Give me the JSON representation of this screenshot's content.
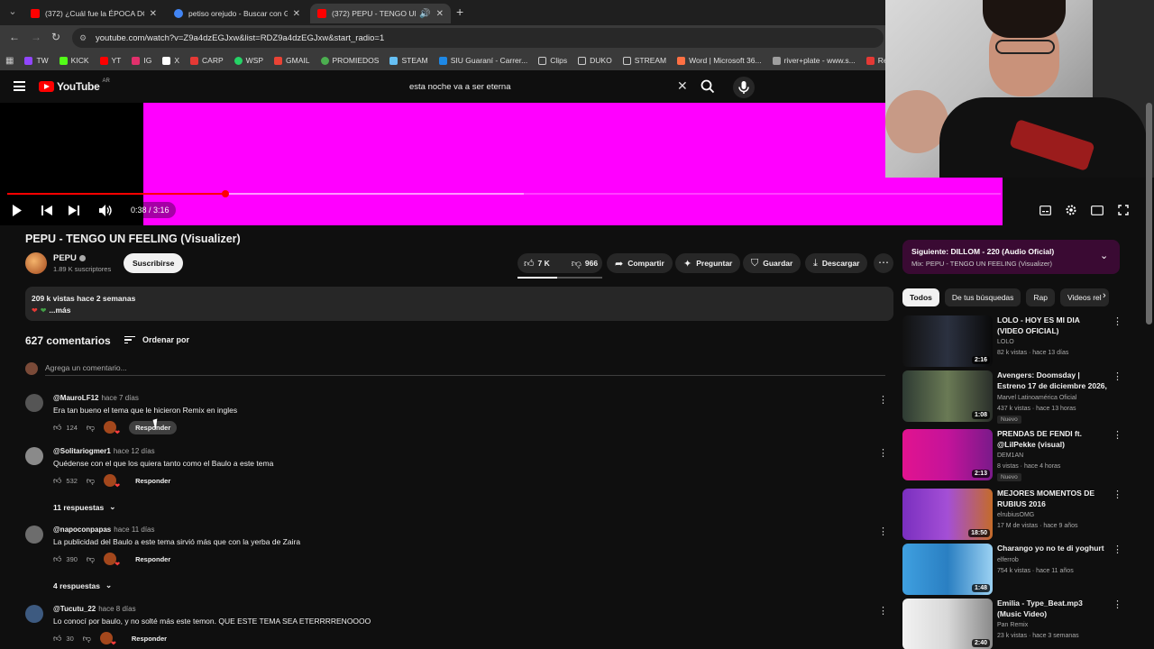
{
  "browser": {
    "tabs": [
      {
        "title": "(372) ¿Cuál fue la ÉPOCA DORA",
        "favicon_color": "#ff0000",
        "active": false
      },
      {
        "title": "petiso orejudo - Buscar con Go",
        "favicon_color": "#4285f4",
        "active": false
      },
      {
        "title": "(372) PEPU - TENGO UN FE",
        "favicon_color": "#ff0000",
        "active": true
      }
    ],
    "new_tab": "+",
    "url": "youtube.com/watch?v=Z9a4dzEGJxw&list=RDZ9a4dzEGJxw&start_radio=1",
    "bookmarks": [
      {
        "label": "TW",
        "color": "#1d9bf0"
      },
      {
        "label": "KICK",
        "color": "#53fc18"
      },
      {
        "label": "YT",
        "color": "#ff0000"
      },
      {
        "label": "IG",
        "color": "#e1306c"
      },
      {
        "label": "X",
        "color": "#ffffff"
      },
      {
        "label": "CARP",
        "color": "#e53935"
      },
      {
        "label": "WSP",
        "color": "#25d366"
      },
      {
        "label": "GMAIL",
        "color": "#ea4335"
      },
      {
        "label": "PROMIEDOS",
        "color": "#4caf50"
      },
      {
        "label": "STEAM",
        "color": "#66c0f4"
      },
      {
        "label": "SIU Guaraní - Carrer...",
        "color": "#1e88e5"
      },
      {
        "label": "Clips",
        "color": "#9e9e9e"
      },
      {
        "label": "DUKO",
        "color": "#9e9e9e"
      },
      {
        "label": "STREAM",
        "color": "#9e9e9e"
      },
      {
        "label": "Word | Microsoft 36...",
        "color": "#ff7043"
      },
      {
        "label": "river+plate - www.s...",
        "color": "#9e9e9e"
      },
      {
        "label": "Retro Co",
        "color": "#e53935"
      }
    ]
  },
  "youtube": {
    "logo_text": "YouTube",
    "country": "AR",
    "search_query": "esta noche va a ser eterna"
  },
  "player": {
    "current_time": "0:38",
    "duration": "3:16",
    "progress_fraction": 0.22,
    "buffer_fraction": 0.52
  },
  "video": {
    "title": "PEPU - TENGO UN FEELING (Visualizer)",
    "channel": "PEPU",
    "subscribers": "1.89 K suscriptores",
    "subscribe_label": "Suscribirse",
    "likes": "7 K",
    "dislikes": "966",
    "share_label": "Compartir",
    "ask_label": "Preguntar",
    "save_label": "Guardar",
    "download_label": "Descargar",
    "views_time": "209 k vistas  hace 2 semanas",
    "more_label": "...más"
  },
  "comments_section": {
    "count": "627 comentarios",
    "sort_label": "Ordenar por",
    "add_placeholder": "Agrega un comentario...",
    "reply_label": "Responder",
    "comments": [
      {
        "author": "@MauroLF12",
        "time": "hace 7 días",
        "text": "Era tan bueno el tema que le hicieron Remix en ingles",
        "likes": "124",
        "replies": "",
        "avatar_color": "#555555"
      },
      {
        "author": "@Solitariogmer1",
        "time": "hace 12 días",
        "text": "Quédense con el que los quiera tanto como el Baulo a este tema",
        "likes": "532",
        "replies": "11 respuestas",
        "avatar_color": "#8a8a8a"
      },
      {
        "author": "@napoconpapas",
        "time": "hace 11 días",
        "text": "La publicidad del Baulo a este tema sirvió más que con la yerba de Zaira",
        "likes": "390",
        "replies": "4 respuestas",
        "avatar_color": "#6d6d6d"
      },
      {
        "author": "@Tucutu_22",
        "time": "hace 8 días",
        "text": "Lo conocí por baulo, y no solté más este temon. QUE ESTE TEMA SEA ETERRRRENOOOO",
        "likes": "30",
        "replies": "",
        "avatar_color": "#3d5a80"
      }
    ]
  },
  "sidebar": {
    "up_next_label": "Siguiente:",
    "up_next_title": "DILLOM - 220 (Audio Oficial)",
    "up_next_mix": "Mix: PEPU - TENGO UN FEELING (Visualizer)",
    "chips": [
      "Todos",
      "De tus búsquedas",
      "Rap",
      "Videos rel"
    ],
    "recommendations": [
      {
        "title": "LOLO - HOY ES MI DIA (VIDEO OFICIAL)",
        "channel": "LOLO",
        "meta": "82 k vistas · hace 13 días",
        "duration": "2:16",
        "badge": "",
        "thumb_color": "#2b3140"
      },
      {
        "title": "Avengers: Doomsday | Estreno 17 de diciembre 2026, solo en ...",
        "channel": "Marvel Latinoamérica Oficial",
        "meta": "437 k vistas · hace 13 horas",
        "duration": "1:08",
        "badge": "Nuevo",
        "thumb_color": "#4a5a4d"
      },
      {
        "title": "PRENDAS DE FENDI ft. @LilPekke  (visual)",
        "channel": "DEM1AN",
        "meta": "8 vistas · hace 4 horas",
        "duration": "2:13",
        "badge": "Nuevo",
        "thumb_color": "#c4139a"
      },
      {
        "title": "MEJORES MOMENTOS DE RUBIUS 2016",
        "channel": "elrubiusOMG",
        "meta": "17 M de vistas · hace 9 años",
        "duration": "18:50",
        "badge": "",
        "thumb_color": "#6a2aa8"
      },
      {
        "title": "Charango yo no te di yoghurt",
        "channel": "elferrob",
        "meta": "754 k vistas · hace 11 años",
        "duration": "1:48",
        "badge": "",
        "thumb_color": "#2a7fc2"
      },
      {
        "title": "Emilia - Type_Beat.mp3 (Music Video)",
        "channel": "Pan Remix",
        "meta": "23 k vistas · hace 3 semanas",
        "duration": "2:40",
        "badge": "",
        "thumb_color": "#d8d8d8"
      }
    ]
  }
}
